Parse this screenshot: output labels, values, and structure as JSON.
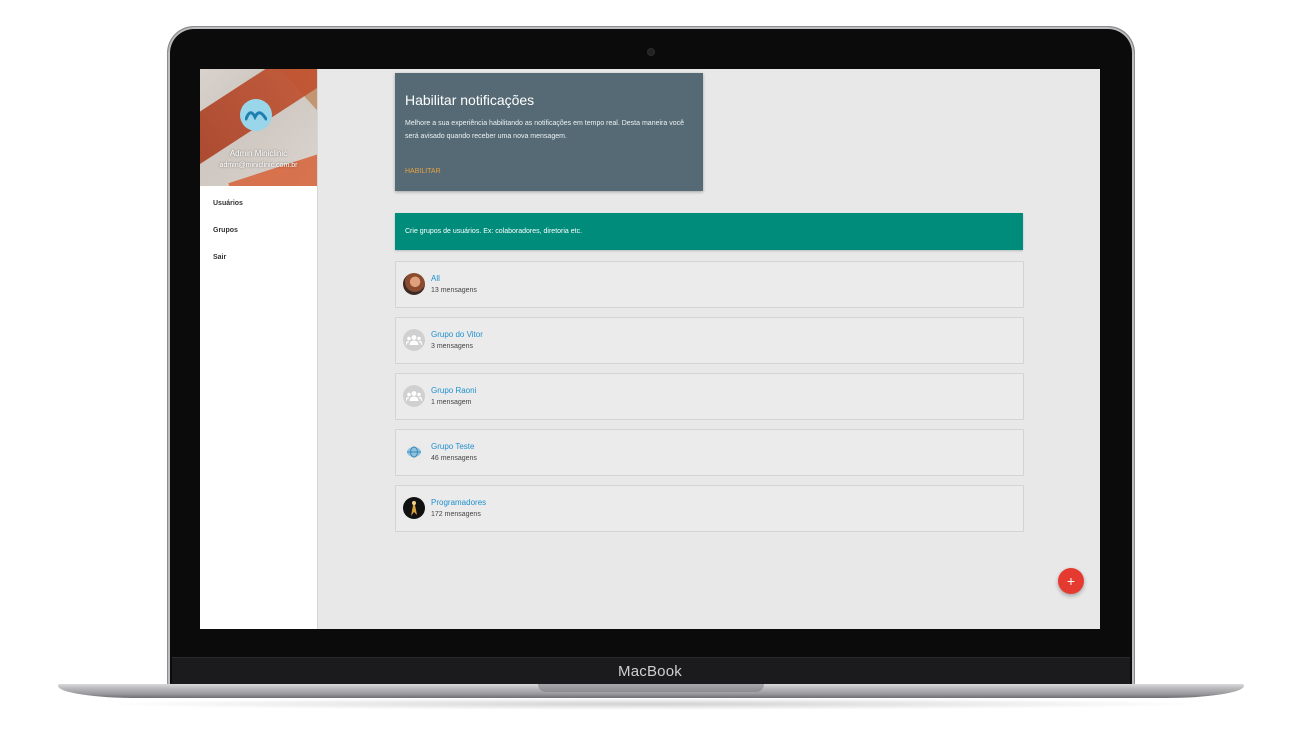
{
  "device": {
    "brand_label": "MacBook"
  },
  "profile": {
    "name": "Admin Miniclinic",
    "email": "admin@miniclinic.com.br",
    "avatar_icon": "miniclinic-logo-icon"
  },
  "sidebar": {
    "items": [
      {
        "label": "Usuários"
      },
      {
        "label": "Grupos"
      },
      {
        "label": "Sair"
      }
    ]
  },
  "notification": {
    "title": "Habilitar notificações",
    "body": "Melhore a sua experiência habilitando as notificações em tempo real. Desta maneira você será avisado quando receber uma nova mensagem.",
    "action_label": "HABILITAR"
  },
  "banner": {
    "text": "Crie grupos de usuários. Ex: colaboradores, diretoria etc."
  },
  "groups": [
    {
      "name": "All",
      "count": "13 mensagens",
      "icon": "photo-avatar-icon"
    },
    {
      "name": "Grupo do Vitor",
      "count": "3 mensagens",
      "icon": "group-people-icon"
    },
    {
      "name": "Grupo Raoni",
      "count": "1 mensagem",
      "icon": "group-people-icon"
    },
    {
      "name": "Grupo Teste",
      "count": "46 mensagens",
      "icon": "globe-icon"
    },
    {
      "name": "Programadores",
      "count": "172 mensagens",
      "icon": "photo-avatar-icon"
    }
  ],
  "fab": {
    "label": "+",
    "icon": "add-icon"
  },
  "colors": {
    "notification_bg": "#556a74",
    "action": "#e6a244",
    "banner": "#008c7a",
    "link": "#1f8fcf",
    "fab": "#e53a2f"
  }
}
